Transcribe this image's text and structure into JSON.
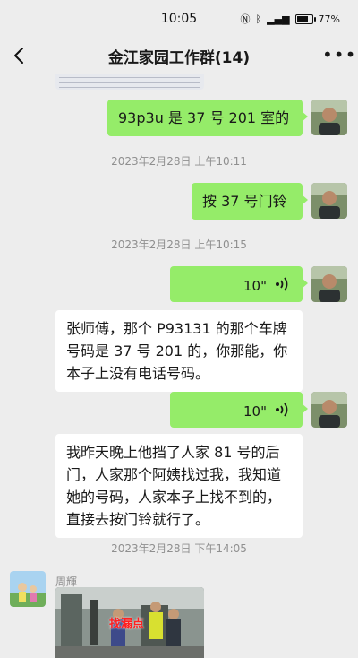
{
  "status": {
    "time": "10:05",
    "battery": "77%"
  },
  "nav": {
    "title": "金江家园工作群(14)"
  },
  "messages": {
    "m1": "93p3u 是 37 号 201 室的",
    "ts1": "2023年2月28日 上午10:11",
    "m2": "按 37 号门铃",
    "ts2": "2023年2月28日 上午10:15",
    "voice1": "10\"",
    "m3": "张师傅，那个 P93131 的那个车牌号码是 37 号 201 的，你那能，你本子上没有电话号码。",
    "voice2": "10\"",
    "m4": "我昨天晚上他挡了人家 81 号的后门，人家那个阿姨找过我，我知道她的号码，人家本子上找不到的，直接去按门铃就行了。",
    "ts3": "2023年2月28日 下午14:05",
    "sender": "周輝",
    "photo_label": "找漏点"
  }
}
